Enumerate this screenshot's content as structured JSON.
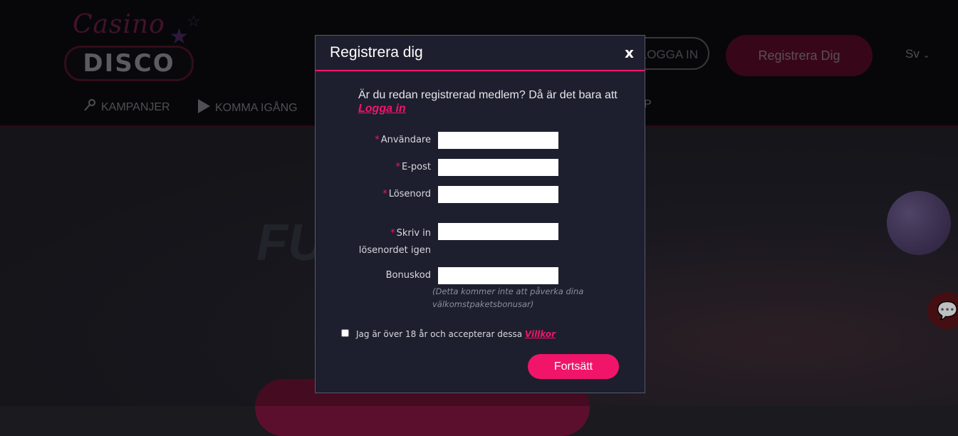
{
  "background": {
    "logo_top": "Casino",
    "logo_main": "DISCO",
    "login_label": "LOGGA IN",
    "register_label": "Registrera Dig",
    "language": "Sv",
    "nav": [
      {
        "label": "KAMPANJER",
        "icon": "microphone-icon"
      },
      {
        "label": "KOMMA IGÅNG",
        "icon": "play-icon"
      }
    ],
    "nav_cut_text": "P",
    "hero_text": "FU"
  },
  "modal": {
    "title": "Registrera dig",
    "close_label": "x",
    "intro": "Är du redan registrerad medlem? Då är det bara att",
    "intro_link": "Logga in",
    "fields": {
      "username_label": "Användare",
      "email_label": "E-post",
      "password_label": "Lösenord",
      "repeat_label_line1": "Skriv in",
      "repeat_label_line2": "lösenordet igen",
      "bonus_label": "Bonuskod",
      "required_mark": "*"
    },
    "bonus_hint_line1": "(Detta kommer inte att påverka dina",
    "bonus_hint_line2": "välkomstpaketsbonusar)",
    "terms_text": "Jag är över 18 år och accepterar dessa",
    "terms_link": "Villkor",
    "submit_label": "Fortsätt"
  },
  "colors": {
    "accent": "#f1156a",
    "modal_bg": "#1e1f2e"
  }
}
